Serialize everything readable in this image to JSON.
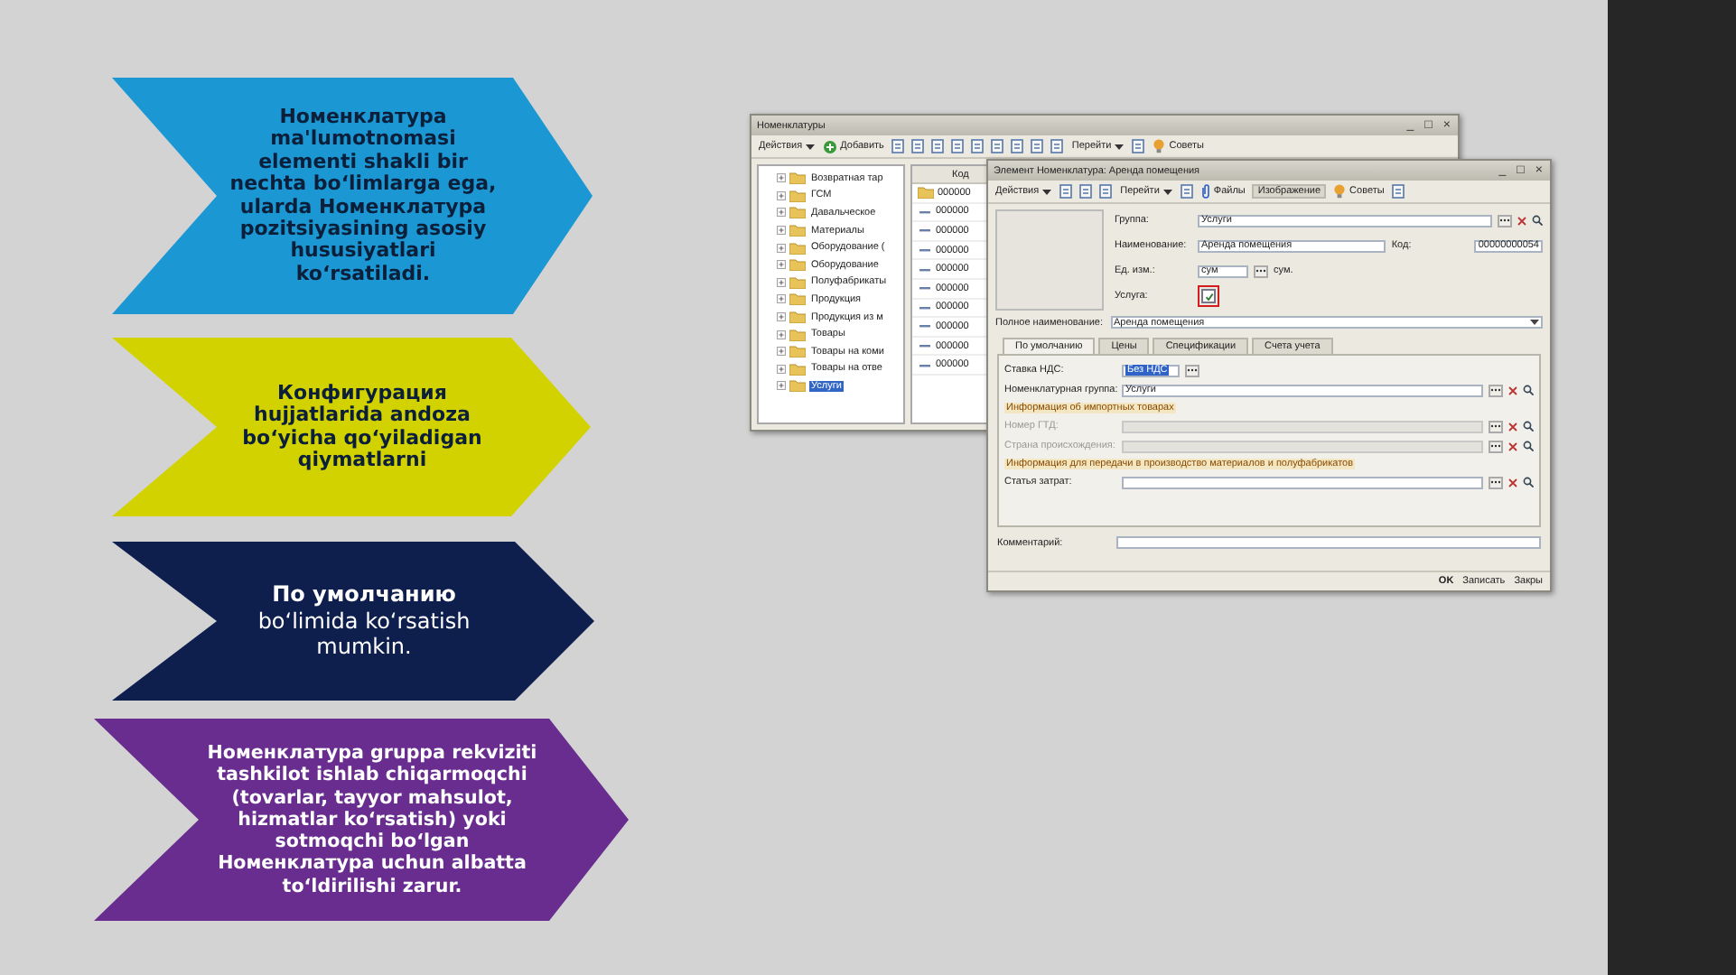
{
  "arrows": [
    {
      "kind": "dark-bold",
      "color": "#1b98d3",
      "text": "Номенклатура ma'lumotnomasi elementi shakli bir nechta bo‘limlarga ega, ularda Номенклатура pozitsiyasining asosiy hususiyatlari ko‘rsatiladi."
    },
    {
      "kind": "dark-bold",
      "color": "#d2d200",
      "text": "Конфигурация hujjatlarida andoza bo‘yicha qo‘yiladigan qiymatlarni"
    },
    {
      "kind": "light",
      "color": "#0e1f4e",
      "text": "**По умолчанию** bo‘limida ko‘rsatish mumkin."
    },
    {
      "kind": "light-bold",
      "color": "#692d8f",
      "text": "Номенклатура  gruppa rekviziti tashkilot ishlab chiqarmoqchi (tovarlar, tayyor mahsulot, hizmatlar ko‘rsatish) yoki sotmoqchi bo‘lgan Номенклатура uchun albatta to‘ldirilishi zarur."
    }
  ],
  "screenshot": {
    "list_window": {
      "title": "Номенклатуры",
      "controls": [
        "_",
        "□",
        "×"
      ],
      "toolbar": [
        {
          "kind": "menu",
          "label": "Действия"
        },
        {
          "kind": "add",
          "label": "Добавить"
        },
        {
          "kind": "icon"
        },
        {
          "kind": "icon"
        },
        {
          "kind": "icon"
        },
        {
          "kind": "icon"
        },
        {
          "kind": "icon"
        },
        {
          "kind": "icon"
        },
        {
          "kind": "icon"
        },
        {
          "kind": "icon"
        },
        {
          "kind": "icon"
        },
        {
          "kind": "menu",
          "label": "Перейти"
        },
        {
          "kind": "icon"
        },
        {
          "kind": "tips",
          "label": "Советы"
        }
      ],
      "tree": [
        {
          "label": "Возвратная тар",
          "selected": false
        },
        {
          "label": "ГСМ",
          "selected": false
        },
        {
          "label": "Давальческое",
          "selected": false
        },
        {
          "label": "Материалы",
          "selected": false
        },
        {
          "label": "Оборудование (",
          "selected": false
        },
        {
          "label": "Оборудование",
          "selected": false
        },
        {
          "label": "Полуфабрикаты",
          "selected": false
        },
        {
          "label": "Продукция",
          "selected": false
        },
        {
          "label": "Продукция из м",
          "selected": false
        },
        {
          "label": "Товары",
          "selected": false
        },
        {
          "label": "Товары на коми",
          "selected": false
        },
        {
          "label": "Товары на отве",
          "selected": false
        },
        {
          "label": "Услуги",
          "selected": true
        }
      ],
      "code_header": "Код",
      "rows": [
        {
          "kind": "folder",
          "code": "000000"
        },
        {
          "kind": "item",
          "code": "000000"
        },
        {
          "kind": "item",
          "code": "000000"
        },
        {
          "kind": "item",
          "code": "000000"
        },
        {
          "kind": "item",
          "code": "000000"
        },
        {
          "kind": "item",
          "code": "000000"
        },
        {
          "kind": "item",
          "code": "000000"
        },
        {
          "kind": "item",
          "code": "000000"
        },
        {
          "kind": "item",
          "code": "000000"
        },
        {
          "kind": "item",
          "code": "000000"
        }
      ]
    },
    "item_window": {
      "title": "Элемент Номенклатура: Аренда помещения",
      "controls": [
        "_",
        "□",
        "×"
      ],
      "toolbar": [
        {
          "kind": "menu",
          "label": "Действия"
        },
        {
          "kind": "icon"
        },
        {
          "kind": "icon"
        },
        {
          "kind": "icon"
        },
        {
          "kind": "menu",
          "label": "Перейти"
        },
        {
          "kind": "icon"
        },
        {
          "kind": "files",
          "label": "Файлы"
        },
        {
          "kind": "text",
          "label": "Изображение"
        },
        {
          "kind": "tips",
          "label": "Советы"
        },
        {
          "kind": "icon"
        }
      ],
      "fields": [
        {
          "kind": "choice",
          "label": "Группа:",
          "value": "Услуги"
        },
        {
          "kind": "text",
          "label": "Наименование:",
          "value": "Аренда помещения"
        },
        {
          "kind": "unit",
          "label": "Ед. изм.:",
          "value": "сум",
          "suffix": "сум."
        },
        {
          "kind": "checkbox",
          "label": "Услуга:",
          "checked": true
        }
      ],
      "code": {
        "label": "Код:",
        "value": "00000000054"
      },
      "full_name": {
        "label": "Полное наименование:",
        "value": "Аренда помещения"
      },
      "tabs": [
        {
          "label": "По умолчанию",
          "selected": true
        },
        {
          "label": "Цены",
          "selected": false
        },
        {
          "label": "Спецификации",
          "selected": false
        },
        {
          "label": "Счета учета",
          "selected": false
        }
      ],
      "tab_fields": [
        {
          "kind": "short",
          "label": "Ставка НДС:",
          "value": "Без НДС",
          "highlighted": true,
          "disabled": false
        },
        {
          "kind": "choice",
          "label": "Номенклатурная группа:",
          "value": "Услуги",
          "highlighted": false,
          "disabled": false
        },
        {
          "kind": "heading",
          "label": "Информация об импортных товарах"
        },
        {
          "kind": "choice",
          "label": "Номер ГТД:",
          "disabled": true
        },
        {
          "kind": "choice",
          "label": "Страна происхождения:",
          "disabled": true
        },
        {
          "kind": "heading",
          "label": "Информация для передачи в производство материалов и полуфабрикатов"
        },
        {
          "kind": "choice",
          "label": "Статья затрат:",
          "disabled": false
        }
      ],
      "comment": {
        "label": "Комментарий:"
      },
      "footer": [
        {
          "label": "OK",
          "default": true
        },
        {
          "label": "Записать",
          "default": false
        },
        {
          "label": "Закры",
          "default": false
        }
      ]
    }
  }
}
